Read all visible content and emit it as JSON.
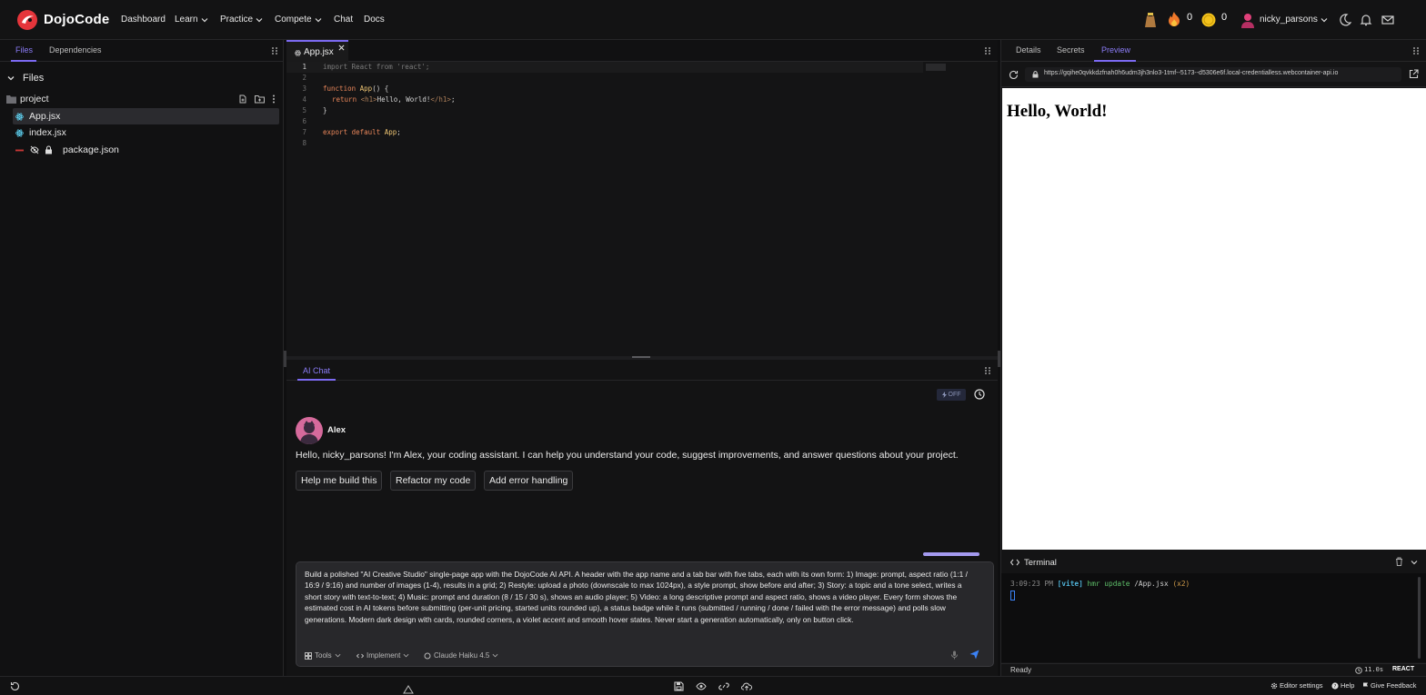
{
  "header": {
    "brand": "DojoCode",
    "nav": [
      {
        "label": "Dashboard",
        "caret": false
      },
      {
        "label": "Learn",
        "caret": true
      },
      {
        "label": "Practice",
        "caret": true
      },
      {
        "label": "Compete",
        "caret": true
      },
      {
        "label": "Chat",
        "caret": false
      },
      {
        "label": "Docs",
        "caret": false
      }
    ],
    "streak_count": "0",
    "coin_count": "0",
    "username": "nicky_parsons",
    "accent_color": "#7c6af2"
  },
  "left_panel": {
    "tabs": [
      "Files",
      "Dependencies"
    ],
    "files_title": "Files",
    "folder_name": "project",
    "files": [
      {
        "name": "App.jsx",
        "icon": "react-icon",
        "selected": true
      },
      {
        "name": "index.jsx",
        "icon": "react-icon",
        "selected": false
      },
      {
        "name": "package.json",
        "icon": "json-icon",
        "selected": false
      }
    ]
  },
  "editor": {
    "tab_label": "App.jsx",
    "lines": [
      {
        "n": "1"
      },
      {
        "n": "2"
      },
      {
        "n": "3"
      },
      {
        "n": "4"
      },
      {
        "n": "5"
      },
      {
        "n": "6"
      },
      {
        "n": "7"
      },
      {
        "n": "8"
      }
    ],
    "code": {
      "l1_import": "import",
      "l1_react": "React",
      "l1_from": "from",
      "l1_str": "'react';",
      "l3_function": "function",
      "l3_name": "App",
      "l3_rest": "() {",
      "l4_return": "return",
      "l4_open": "<h1>",
      "l4_text": "Hello, World!",
      "l4_close": "</h1>",
      "l4_semi": ";",
      "l5": "}",
      "l7_export": "export",
      "l7_default": "default",
      "l7_name": "App",
      "l7_semi": ";"
    }
  },
  "chat": {
    "tab_label": "AI Chat",
    "toggle_label": "OFF",
    "assistant_name": "Alex",
    "greeting": "Hello, nicky_parsons! I'm Alex, your coding assistant. I can help you understand your code, suggest improvements, and answer questions about your project.",
    "suggestions": [
      "Help me build this",
      "Refactor my code",
      "Add error handling"
    ],
    "prompt_text": "Build a polished \"AI Creative Studio\" single-page app with the DojoCode AI API. A header with the app name and a tab bar with five tabs, each with its own form: 1) Image: prompt, aspect ratio (1:1 / 16:9 / 9:16) and number of images (1-4), results in a grid; 2) Restyle: upload a photo (downscale to max 1024px), a style prompt, show before and after; 3) Story: a topic and a tone select, writes a short story with text-to-text; 4) Music: prompt and duration (8 / 15 / 30 s), shows an audio player; 5) Video: a long descriptive prompt and aspect ratio, shows a video player. Every form shows the estimated cost in AI tokens before submitting (per-unit pricing, started units rounded up), a status badge while it runs (submitted / running / done / failed with the error message) and polls slow generations. Modern dark design with cards, rounded corners, a violet accent and smooth hover states. Never start a generation automatically, only on button click.",
    "tools_label": "Tools",
    "mode_label": "Implement",
    "model_label": "Claude Haiku 4.5"
  },
  "right_panel": {
    "tabs": [
      "Details",
      "Secrets",
      "Preview"
    ],
    "url": "https://gqihe0qvkkdzfnah0h6udm3jh3nlo3-1tmf--5173--d5306e6f.local-credentialless.webcontainer-api.io",
    "preview_heading": "Hello, World!",
    "terminal_title": "Terminal",
    "terminal_time": "3:09:23 PM",
    "terminal_tag": "[vite]",
    "terminal_msg": "hmr update",
    "terminal_path": "/App.jsx",
    "terminal_count": "(x2)",
    "status": "Ready",
    "timer": "11.0s",
    "framework": "REACT"
  },
  "statusbar": {
    "editor_settings": "Editor settings",
    "help": "Help",
    "feedback": "Give Feedback"
  }
}
